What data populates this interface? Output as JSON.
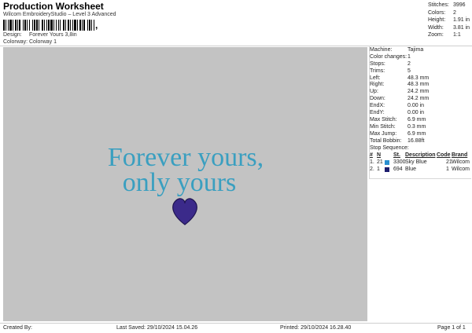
{
  "header": {
    "title": "Production Worksheet",
    "subtitle": "Wilcom EmbroideryStudio – Level 3 Advanced",
    "barcode_tail": ","
  },
  "design_info": {
    "design_label": "Design:",
    "design_value": "Forever Yours 3,8in",
    "colorway_label": "Colorway:",
    "colorway_value": "Colorway 1"
  },
  "summary": [
    {
      "label": "Stitches:",
      "value": "3996"
    },
    {
      "label": "Colors:",
      "value": "2"
    },
    {
      "label": "Height:",
      "value": "1.91 in"
    },
    {
      "label": "Width:",
      "value": "3.81 in"
    },
    {
      "label": "Zoom:",
      "value": "1:1"
    }
  ],
  "design_preview": {
    "line1": "Forever yours,",
    "line2": "only yours",
    "text_color": "#3a9fc0",
    "heart_color": "#3b2a8a",
    "background": "#c3c3c3"
  },
  "machine_info": [
    {
      "label": "Machine:",
      "value": "Tajima"
    },
    {
      "label": "Color changes:",
      "value": "1"
    },
    {
      "label": "Stops:",
      "value": "2"
    },
    {
      "label": "Trims:",
      "value": "5"
    },
    {
      "label": "Left:",
      "value": "48.3 mm"
    },
    {
      "label": "Right:",
      "value": "48.3 mm"
    },
    {
      "label": "Up:",
      "value": "24.2 mm"
    },
    {
      "label": "Down:",
      "value": "24.2 mm"
    },
    {
      "label": "EndX:",
      "value": "0.00 in"
    },
    {
      "label": "EndY:",
      "value": "0.00 in"
    },
    {
      "label": "Max Stitch:",
      "value": "6.9 mm"
    },
    {
      "label": "Min Stitch:",
      "value": "0.3 mm"
    },
    {
      "label": "Max Jump:",
      "value": "6.9 mm"
    },
    {
      "label": "Total Bobbin:",
      "value": "16.88ft"
    }
  ],
  "stop_sequence": {
    "title": "Stop Sequence:",
    "headers": {
      "num": "#",
      "n": "N",
      "st": "St.",
      "description": "Description",
      "code": "Code",
      "brand": "Brand"
    },
    "rows": [
      {
        "num": "1.",
        "n": "21",
        "color": "#2a8fd0",
        "st": "3300",
        "description": "Sky Blue",
        "code": "21",
        "brand": "Wilcom"
      },
      {
        "num": "2.",
        "n": "1",
        "color": "#1d1d6e",
        "st": "694",
        "description": "Blue",
        "code": "1",
        "brand": "Wilcom"
      }
    ]
  },
  "footer": {
    "created": "Created By:",
    "last_saved": "Last Saved: 29/10/2024 15.04.26",
    "printed": "Printed: 29/10/2024 16.28.40",
    "page": "Page 1 of 1"
  }
}
